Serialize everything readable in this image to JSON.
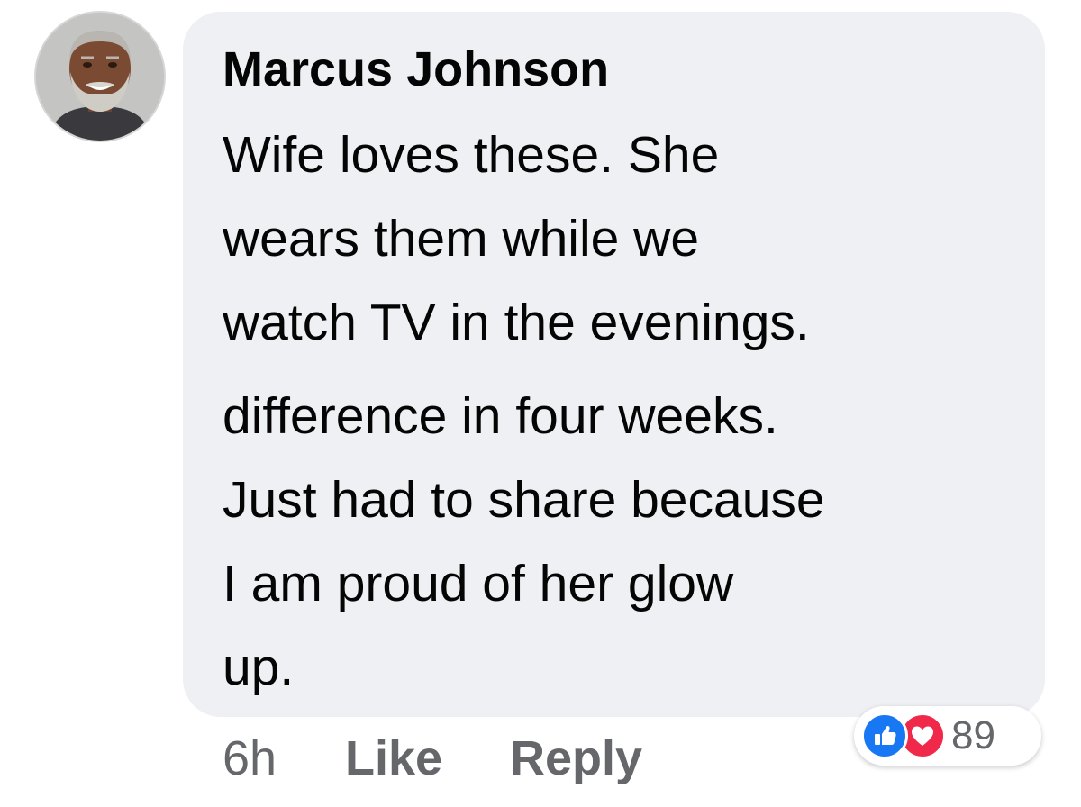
{
  "comment": {
    "author": "Marcus Johnson",
    "paragraph1": [
      "Wife loves these. She",
      "wears them while we",
      "watch TV in the evenings."
    ],
    "paragraph2": [
      "difference in four weeks.",
      "Just had to share because",
      "I am proud of her glow",
      "up."
    ],
    "timestamp": "6h",
    "like_label": "Like",
    "reply_label": "Reply",
    "reactions": {
      "icons": [
        "thumbs-up-icon",
        "heart-icon"
      ],
      "count": "89"
    }
  },
  "colors": {
    "bubble": "#eff0f4",
    "text": "#050505",
    "meta": "#65676b",
    "like_reaction": "#1877f2",
    "love_reaction": "#f02849"
  }
}
